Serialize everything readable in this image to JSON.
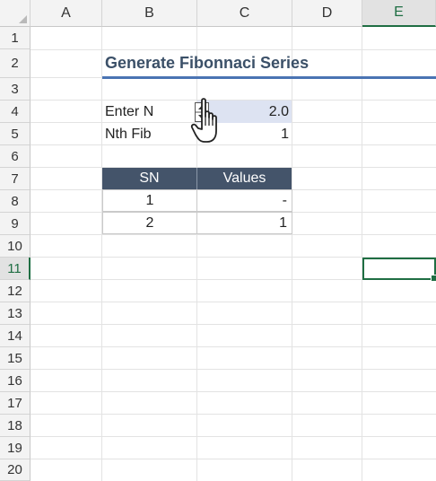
{
  "columns": [
    "A",
    "B",
    "C",
    "D",
    "E"
  ],
  "active_column": "E",
  "rows": [
    "1",
    "2",
    "3",
    "4",
    "5",
    "6",
    "7",
    "8",
    "9",
    "10",
    "11",
    "12",
    "13",
    "14",
    "15",
    "16",
    "17",
    "18",
    "19",
    "20"
  ],
  "active_row": "11",
  "sheet": {
    "title": "Generate Fibonnaci Series",
    "enter_n_label": "Enter N",
    "enter_n_value": "2.0",
    "nth_fib_label": "Nth Fib",
    "nth_fib_value": "1",
    "table": {
      "headers": [
        "SN",
        "Values"
      ],
      "rows": [
        {
          "sn": "1",
          "value": "-"
        },
        {
          "sn": "2",
          "value": "1"
        }
      ]
    }
  },
  "colors": {
    "accent_green": "#1f6e43",
    "title_text": "#3b5068",
    "title_rule": "#4a74b3",
    "table_header": "#44546a",
    "input_fill": "#dde3f2"
  },
  "icons": [
    "spin-button-icon",
    "hand-cursor-icon"
  ]
}
